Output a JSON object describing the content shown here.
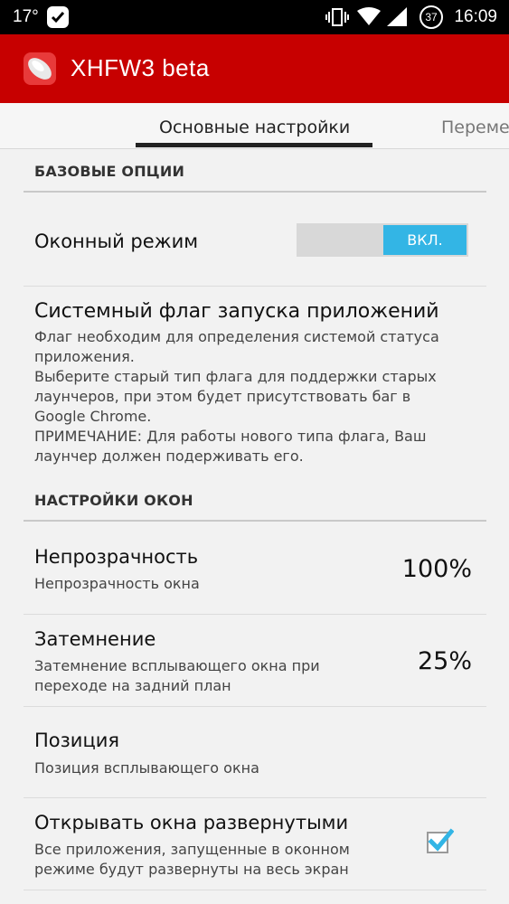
{
  "status_bar": {
    "temperature": "17°",
    "battery_level": "37",
    "time": "16:09"
  },
  "action_bar": {
    "title": "XHFW3 beta",
    "color": "#c70000"
  },
  "tabs": [
    {
      "label": "Основные настройки",
      "active": true
    },
    {
      "label": "Переме",
      "active": false
    }
  ],
  "sections": {
    "basic": {
      "header": "БАЗОВЫЕ ОПЦИИ",
      "window_mode": {
        "title": "Оконный режим",
        "toggle_label": "ВКЛ.",
        "toggle_state": "on"
      },
      "launch_flag": {
        "title": "Системный флаг запуска приложений",
        "description_lines": [
          "Флаг необходим для определения системой статуса",
          "приложения.",
          "Выберите старый тип флага для поддержки старых",
          "лаунчеров, при этом будет присутствовать баг в",
          "Google Chrome.",
          "ПРИМЕЧАНИЕ: Для работы нового типа флага, Ваш",
          "лаунчер должен подерживать его."
        ]
      }
    },
    "window": {
      "header": "НАСТРОЙКИ ОКОН",
      "opacity": {
        "title": "Непрозрачность",
        "subtitle": "Непрозрачность окна",
        "value": "100%"
      },
      "dim": {
        "title": "Затемнение",
        "subtitle_lines": [
          "Затемнение всплывающего окна при",
          "переходе на задний план"
        ],
        "value": "25%"
      },
      "position": {
        "title": "Позиция",
        "subtitle": "Позиция всплывающего окна"
      },
      "maximized": {
        "title": "Открывать окна развернутыми",
        "subtitle_lines": [
          "Все приложения, запущенные в оконном",
          "режиме будут развернуты на весь экран"
        ],
        "checked": true
      }
    }
  },
  "icons": [
    "whatsapp-icon",
    "vibrate-icon",
    "wifi-icon",
    "signal-icon",
    "battery-icon",
    "app-logo-icon",
    "checkmark-icon"
  ]
}
